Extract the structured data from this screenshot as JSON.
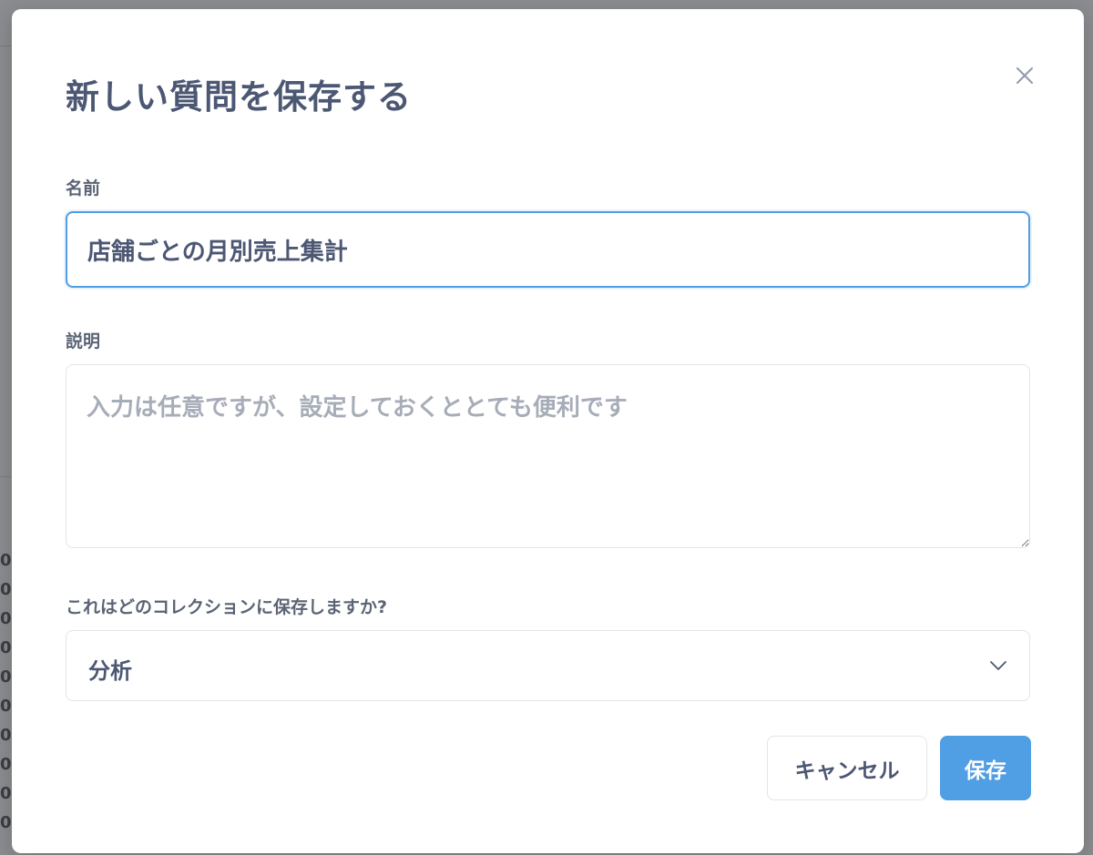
{
  "modal": {
    "title": "新しい質問を保存する",
    "close_icon": "close-icon"
  },
  "form": {
    "name": {
      "label": "名前",
      "value": "店舗ごとの月別売上集計"
    },
    "description": {
      "label": "説明",
      "placeholder": "入力は任意ですが、設定しておくととても便利です",
      "value": ""
    },
    "collection": {
      "label": "これはどのコレクションに保存しますか?",
      "selected": "分析",
      "icon": "chevron-down-icon"
    }
  },
  "actions": {
    "cancel_label": "キャンセル",
    "save_label": "保存"
  },
  "colors": {
    "accent": "#509ee3",
    "text": "#4c5773",
    "border": "#e2e5ea",
    "overlay": "#8a8c8f"
  }
}
